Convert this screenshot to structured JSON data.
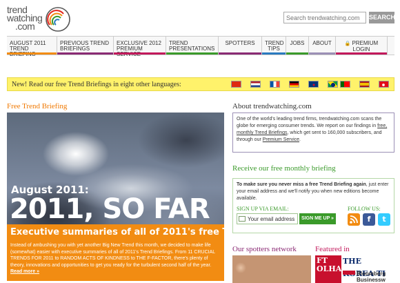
{
  "header": {
    "logo_lines": [
      "trend",
      "watching",
      ".com"
    ],
    "search_placeholder": "Search trendwatching.com",
    "search_button": "SEARCH"
  },
  "nav": {
    "items": [
      {
        "label": "August 2011 Trend Briefing",
        "color": "#f28c12"
      },
      {
        "label": "Previous Trend Briefings",
        "color": "#8a2a74"
      },
      {
        "label": "Exclusive 2012 Premium Service",
        "color": "#c2185b"
      },
      {
        "label": "Trend Presentations",
        "color": "#3a9a2a"
      },
      {
        "label": "Spotters",
        "color": "#8a2a74"
      },
      {
        "label": "Trend Tips",
        "color": "#2a7abf"
      },
      {
        "label": "Jobs",
        "color": "#3a9a2a"
      },
      {
        "label": "About",
        "color": "#9b8fb5"
      },
      {
        "label": "Premium Login",
        "color": "#c2185b"
      }
    ]
  },
  "language_bar": {
    "text": "New! Read our free Trend Briefings in eight other languages:",
    "flags": [
      "china-flag",
      "netherlands-flag",
      "france-flag",
      "germany-flag",
      "korea-flag",
      "brazil-flag",
      "portugal-flag",
      "spain-flag",
      "turkey-flag"
    ]
  },
  "briefing": {
    "section_title": "Free Trend Briefing",
    "subtitle": "August 2011:",
    "headline": "2011, SO FAR",
    "tagline": "Executive summaries of all of 2011's free Trend Briefings",
    "body": "Instead of ambushing you with yet another Big New Trend this month, we decided to make life (somewhat) easier with executive summaries of all of 2011's Trend Briefings. From 11 CRUCIAL TRENDS FOR 2011 to RANDOM ACTS OF KINDNESS to THE F-FACTOR, there's plenty of theory, innovations and opportunities to get you ready for the turbulent second half of the year.",
    "read_more": "Read more »",
    "accent_color": "#f28c12"
  },
  "about": {
    "title": "About trendwatching.com",
    "text_before": "One of the world's leading trend firms, trendwatching.com scans the globe for emerging consumer trends. We report on our findings in ",
    "link1": "free, monthly Trend Briefings",
    "text_middle": ", which get sent to 160,000 subscribers, and through our ",
    "link2": "Premium Service",
    "text_after": "."
  },
  "newsletter": {
    "title": "Receive our free monthly briefing",
    "lead_bold": "To make sure you never miss a free Trend Briefing again",
    "lead_rest": ", just enter your email address and we'll notify you when new editions become available.",
    "signup_label": "SIGN UP VIA EMAIL:",
    "email_value": "Your email address",
    "signup_button": "SIGN ME UP »",
    "follow_label": "FOLLOW US:",
    "accent_color": "#3a9a2a"
  },
  "bottom": {
    "spotters_title": "Our spotters network",
    "featured_title": "Featured in",
    "featured_red_text": "FT\nOLHA",
    "featured_korea": "THE KOREA TI",
    "featured_bloomberg": "Bloomberg\nBusinessw"
  }
}
